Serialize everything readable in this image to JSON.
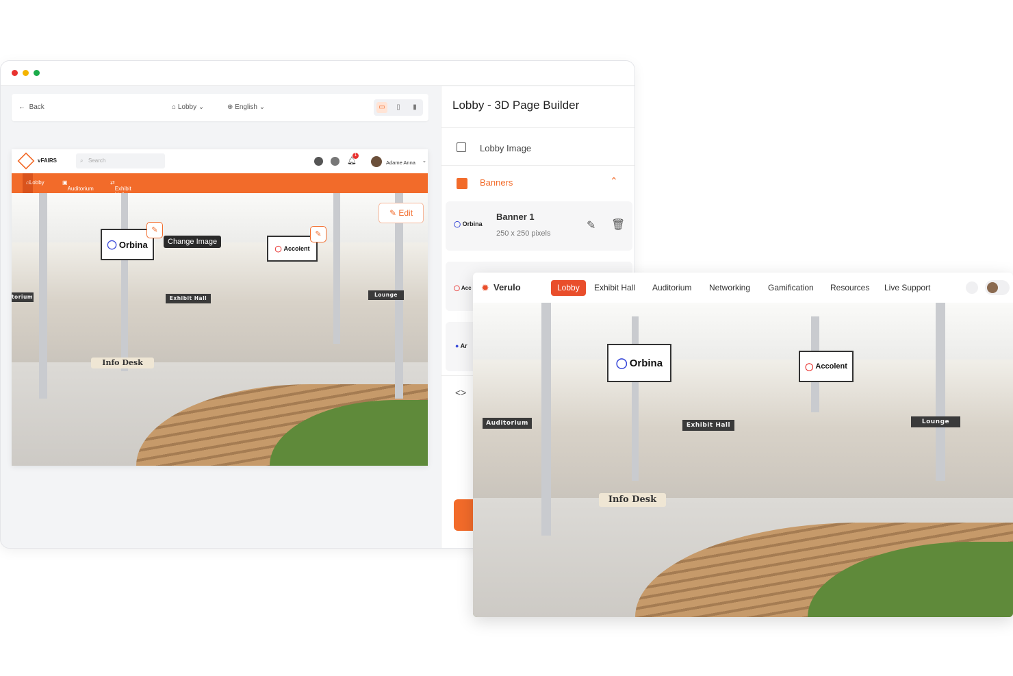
{
  "window": {
    "toolbar": {
      "back_label": "Back",
      "lobby_label": "Lobby",
      "language_label": "English"
    }
  },
  "preview": {
    "brand": "vFAIRS",
    "search_placeholder": "Search",
    "notification_count": "1",
    "user_name": "Adame Anna",
    "nav": [
      "Lobby",
      "Auditorium",
      "Exhibit Hall"
    ],
    "edit_label": "Edit",
    "change_image_tooltip": "Change Image",
    "scene": {
      "orbina": "Orbina",
      "accolent": "Accolent",
      "auditorium": "Auditorium",
      "exhibit_hall": "Exhibit Hall",
      "lounge": "Lounge",
      "info_desk": "Info Desk"
    }
  },
  "panel": {
    "title": "Lobby - 3D Page Builder",
    "lobby_image_label": "Lobby Image",
    "banners_label": "Banners",
    "banner1": {
      "logo": "Orbina",
      "title": "Banner 1",
      "size": "250 x 250 pixels"
    },
    "partial_logo_1": "Acc",
    "partial_logo_2": "Ar",
    "code_label": "<>"
  },
  "front": {
    "brand": "Verulo",
    "nav": [
      "Lobby",
      "Exhibit Hall",
      "Auditorium",
      "Networking",
      "Gamification",
      "Resources",
      "Live Support"
    ],
    "scene": {
      "orbina": "Orbina",
      "accolent": "Accolent",
      "auditorium": "Auditorium",
      "exhibit_hall": "Exhibit Hall",
      "lounge": "Lounge",
      "info_desk": "Info Desk"
    }
  },
  "colors": {
    "accent": "#f26b2a",
    "front_accent": "#e94e2b",
    "traffic_red": "#e8322f",
    "traffic_yellow": "#f4b400",
    "traffic_green": "#1aab4a"
  }
}
